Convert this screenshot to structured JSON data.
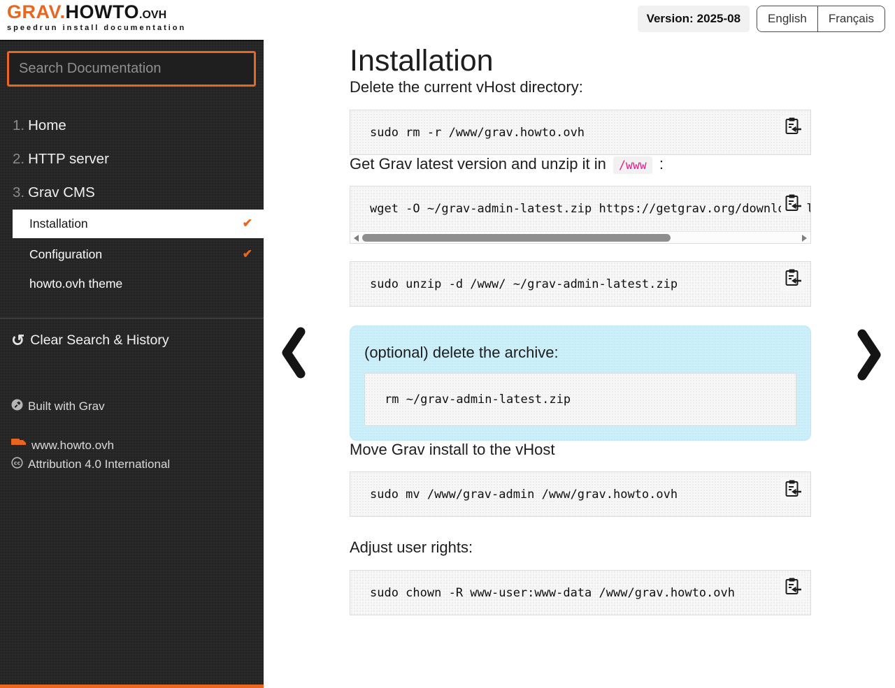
{
  "header": {
    "logo": {
      "part1": "GRAV.",
      "part2": "HOWTO",
      "part3": ".OVH",
      "tagline": "speedrun install documentation"
    },
    "version_label": "Version:",
    "version_value": "2025-08",
    "languages": [
      {
        "label": "English"
      },
      {
        "label": "Français"
      }
    ]
  },
  "sidebar": {
    "search_placeholder": "Search Documentation",
    "nav": [
      {
        "number": "1.",
        "label": "Home"
      },
      {
        "number": "2.",
        "label": "HTTP server"
      },
      {
        "number": "3.",
        "label": "Grav CMS"
      }
    ],
    "subnav": [
      {
        "label": "Installation",
        "checked": true,
        "active": true
      },
      {
        "label": "Configuration",
        "checked": true,
        "active": false
      },
      {
        "label": "howto.ovh theme",
        "checked": false,
        "active": false
      }
    ],
    "clear_history_label": "Clear Search & History",
    "footer": [
      {
        "label": "Built with Grav"
      },
      {
        "label": "www.howto.ovh"
      },
      {
        "label": "Attribution 4.0 International"
      }
    ]
  },
  "main": {
    "title": "Installation",
    "s1": {
      "heading": "Delete the current vHost directory:",
      "code": "sudo rm -r /www/grav.howto.ovh"
    },
    "s2": {
      "heading_pre": "Get Grav latest version and unzip it in",
      "inline_code": "/www",
      "heading_post": ":",
      "code_wget": "wget -O ~/grav-admin-latest.zip https://getgrav.org/download-latest",
      "code_unzip": "sudo unzip -d /www/ ~/grav-admin-latest.zip"
    },
    "callout": {
      "heading": "(optional) delete the archive:",
      "code": "rm ~/grav-admin-latest.zip"
    },
    "s3": {
      "heading": "Move Grav install to the vHost",
      "code": "sudo mv /www/grav-admin /www/grav.howto.ovh"
    },
    "s4": {
      "heading": "Adjust user rights:",
      "code": "sudo chown -R www-user:www-data /www/grav.howto.ovh"
    }
  },
  "icons": {
    "check": "✔",
    "history": "↺"
  },
  "colors": {
    "accent_orange": "#e8661f",
    "sidebar_bg": "#252525",
    "callout_bg": "#cdeff9",
    "inline_code_pink": "#e0218a"
  }
}
